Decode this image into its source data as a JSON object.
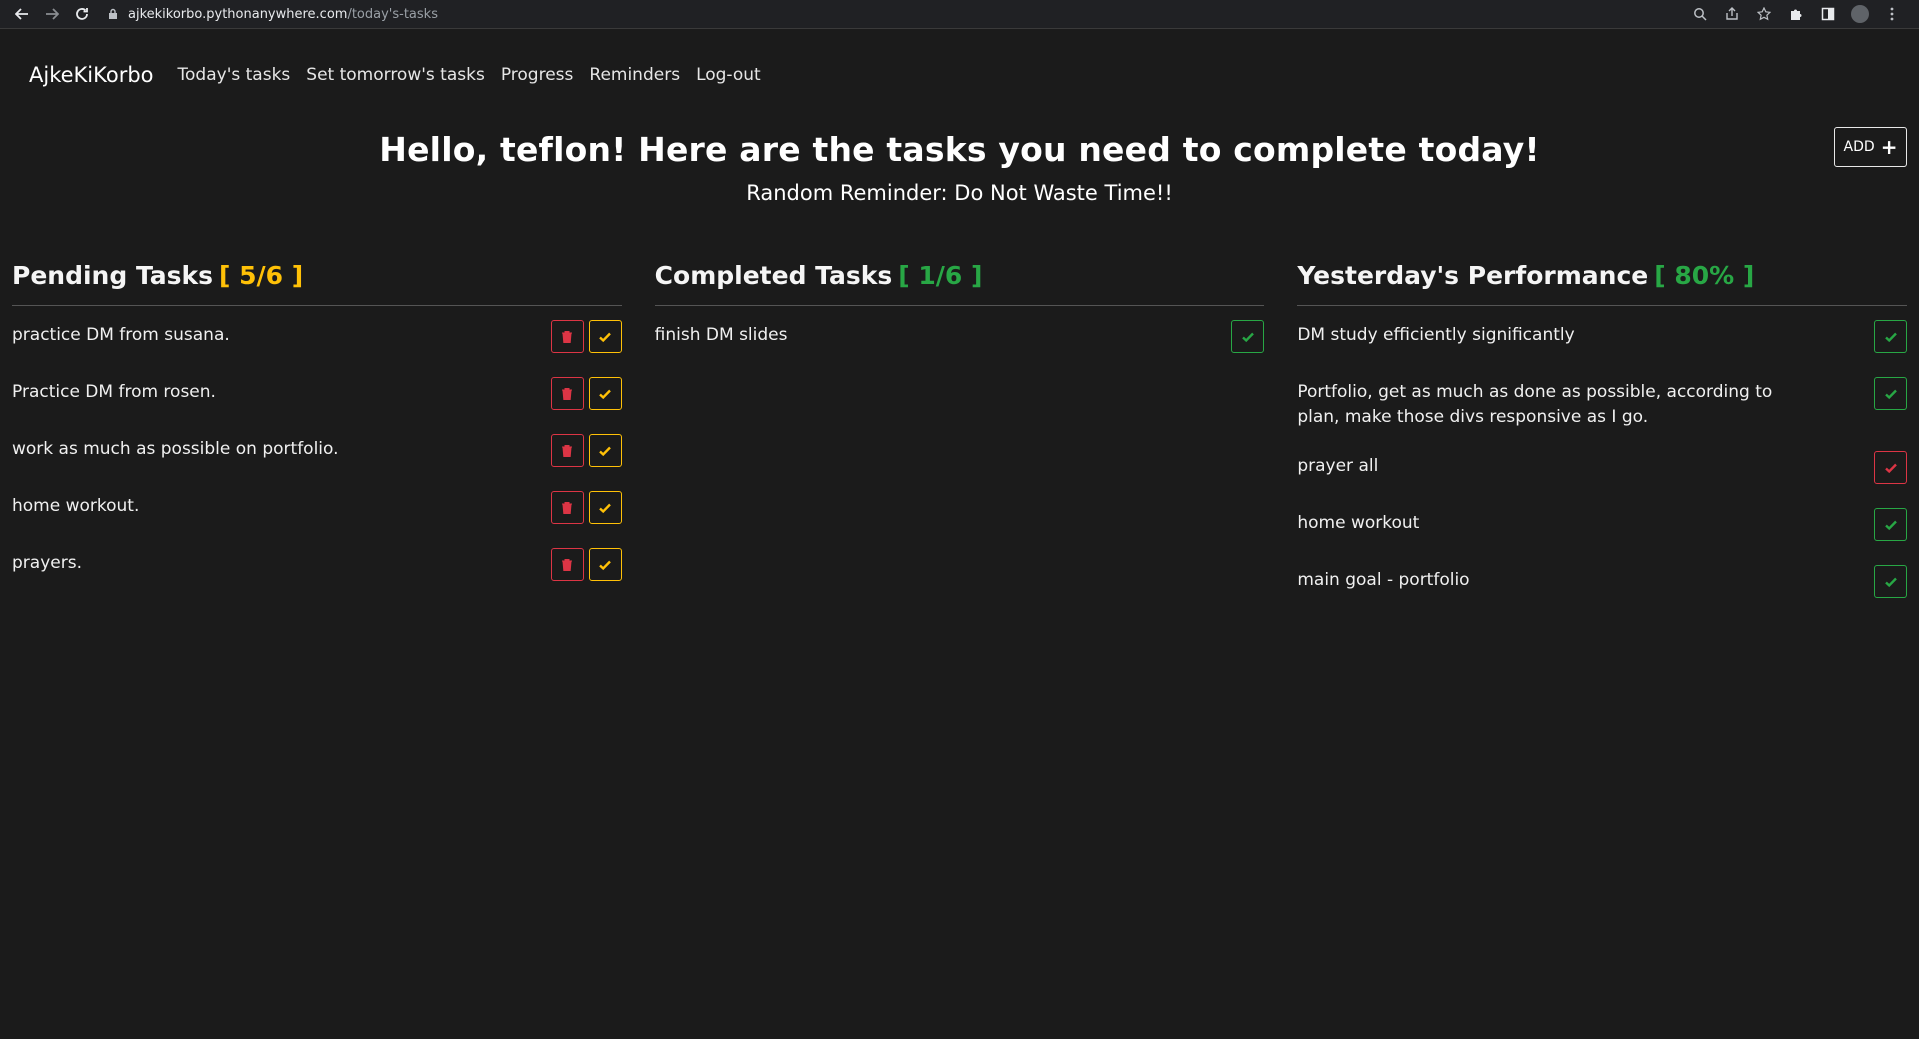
{
  "browser": {
    "url_host": "ajkekikorbo.pythonanywhere.com",
    "url_path": "/today's-tasks"
  },
  "navbar": {
    "brand": "AjkeKiKorbo",
    "links": [
      "Today's tasks",
      "Set tomorrow's tasks",
      "Progress",
      "Reminders",
      "Log-out"
    ]
  },
  "header": {
    "greeting": "Hello, teflon! Here are the tasks you need to complete today!",
    "reminder": "Random Reminder: Do Not Waste Time!!",
    "add_label": "ADD"
  },
  "pending": {
    "title": "Pending Tasks",
    "count": "[ 5/6 ]",
    "tasks": [
      "practice DM from susana.",
      "Practice DM from rosen.",
      "work as much as possible on portfolio.",
      "home workout.",
      "prayers."
    ]
  },
  "completed": {
    "title": "Completed Tasks",
    "count": "[ 1/6 ]",
    "tasks": [
      "finish DM slides"
    ]
  },
  "yesterday": {
    "title": "Yesterday's Performance",
    "count": "[ 80% ]",
    "tasks": [
      {
        "text": "DM study efficiently significantly",
        "status": "done"
      },
      {
        "text": "Portfolio, get as much as done as possible, according to plan, make those divs responsive as I go.",
        "status": "done"
      },
      {
        "text": "prayer all",
        "status": "missed"
      },
      {
        "text": "home workout",
        "status": "done"
      },
      {
        "text": "main goal - portfolio",
        "status": "done"
      }
    ]
  },
  "colors": {
    "yellow": "#ffc107",
    "green": "#28a745",
    "red": "#dc3545",
    "background": "#1b1b1b"
  }
}
